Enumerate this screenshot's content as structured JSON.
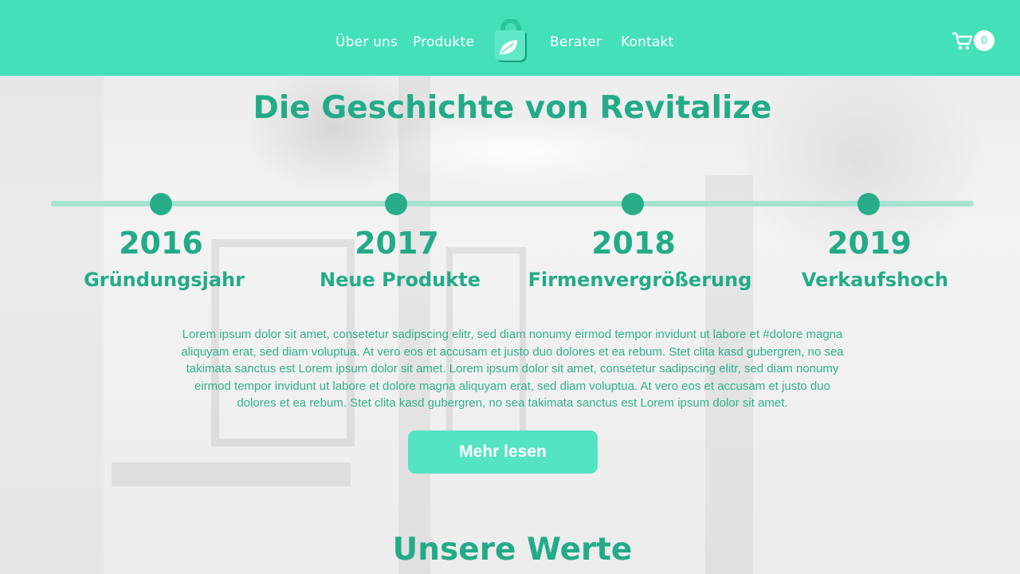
{
  "header": {
    "nav": [
      "Über uns",
      "Produkte",
      "Berater",
      "Kontakt"
    ],
    "cart_count": "0",
    "accent": "#44e0ba"
  },
  "main": {
    "title": "Die Geschichte von Revitalize",
    "timeline": [
      {
        "year": "2016",
        "label": "Gründungsjahr"
      },
      {
        "year": "2017",
        "label": "Neue Produkte"
      },
      {
        "year": "2018",
        "label": "Firmenvergrößerung"
      },
      {
        "year": "2019",
        "label": "Verkaufshoch"
      }
    ],
    "paragraph_lines": [
      "Lorem ipsum dolor sit amet, consetetur sadipscing elitr, sed diam nonumy eirmod tempor invidunt ut labore et #dolore magna",
      "aliquyam erat, sed diam voluptua. At vero eos et accusam et justo duo dolores et ea rebum. Stet clita kasd gubergren, no sea",
      "takimata sanctus est Lorem ipsum dolor sit amet. Lorem ipsum dolor sit amet, consetetur sadipscing elitr, sed diam nonumy",
      "eirmod tempor invidunt ut labore et dolore magna aliquyam erat, sed diam voluptua. At vero eos et accusam et justo duo",
      "dolores et ea rebum. Stet clita kasd gubergren, no sea takimata sanctus est Lorem ipsum dolor sit amet."
    ],
    "button_label": "Mehr lesen",
    "section2_title": "Unsere Werte",
    "text_color": "#23ab88"
  }
}
